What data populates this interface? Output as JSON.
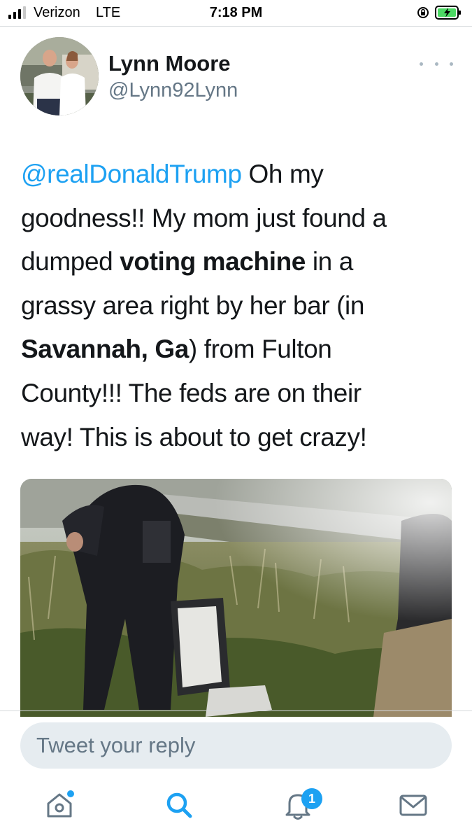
{
  "status_bar": {
    "carrier": "Verizon",
    "network": "LTE",
    "time": "7:18 PM",
    "signal_bars_filled": 3,
    "signal_bars_total": 4,
    "battery_charging": true
  },
  "tweet": {
    "author_name": "Lynn Moore",
    "author_handle": "@Lynn92Lynn",
    "text_lines": [
      [
        {
          "t": "@realDonaldTrump",
          "s": "mention"
        },
        {
          "t": " Oh my",
          "s": ""
        }
      ],
      [
        {
          "t": "goodness!! My mom just found a",
          "s": ""
        }
      ],
      [
        {
          "t": "dumped ",
          "s": ""
        },
        {
          "t": "voting machine",
          "s": "strong"
        },
        {
          "t": " in a",
          "s": ""
        }
      ],
      [
        {
          "t": "grassy area right by her bar (in",
          "s": ""
        }
      ],
      [
        {
          "t": "Savannah, Ga",
          "s": "strong"
        },
        {
          "t": ") from Fulton",
          "s": ""
        }
      ],
      [
        {
          "t": "County!!! The feds are on their",
          "s": ""
        }
      ],
      [
        {
          "t": "way! This is about to get crazy!",
          "s": ""
        }
      ]
    ]
  },
  "reply": {
    "placeholder": "Tweet your reply"
  },
  "tab_bar": {
    "notifications_badge": "1"
  },
  "colors": {
    "accent": "#1da1f2",
    "text": "#14171a",
    "secondary_text": "#657786",
    "reply_background": "#e6ecf0"
  }
}
